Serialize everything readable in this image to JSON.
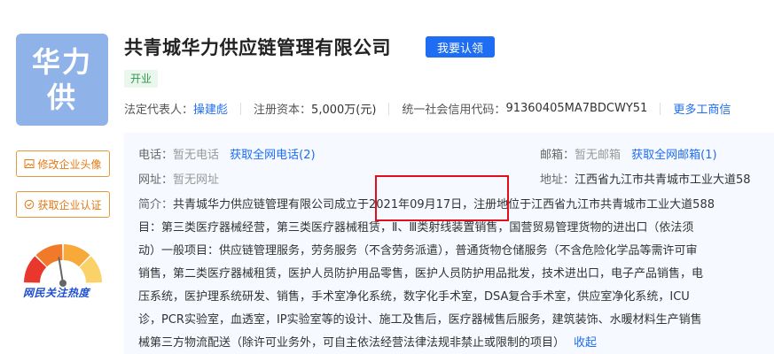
{
  "company": {
    "logo_chars": [
      "华力",
      "供"
    ],
    "name": "共青城华力供应链管理有限公司",
    "claim_label": "我要认领",
    "status": "开业"
  },
  "meta": {
    "legal_rep_label": "法定代表人：",
    "legal_rep": "操建彪",
    "capital_label": "注册资本：",
    "capital": "5,000万(元)",
    "credit_code_label": "统一社会信用代码：",
    "credit_code": "91360405MA7BDCWY51",
    "more_link": "更多工商信"
  },
  "side": {
    "edit_avatar": "修改企业头像",
    "get_cert": "获取企业认证",
    "heat_label": "网民关注热度"
  },
  "contact": {
    "phone_label": "电话：",
    "phone_value": "暂无电话",
    "phone_link": "获取全网电话(2)",
    "email_label": "邮箱：",
    "email_value": "暂无邮箱",
    "email_link": "获取全网邮箱(1)",
    "web_label": "网址：",
    "web_value": "暂无网址",
    "addr_label": "地址：",
    "addr_value": "江西省九江市共青城市工业大道58"
  },
  "intro": {
    "label": "简介：",
    "lines": [
      "共青城华力供应链管理有限公司成立于2021年09月17日，注册地位于江西省九江市共青城市工业大道588",
      "目：第三类医疗器械经营，第三类医疗器械租赁，Ⅱ、Ⅲ类射线装置销售，国营贸易管理货物的进出口（依法须",
      "动）一般项目：供应链管理服务，劳务服务（不含劳务派遣），普通货物仓储服务（不含危险化学品等需许可审",
      "销售，第二类医疗器械租赁，医护人员防护用品零售，医护人员防护用品批发，技术进出口，电子产品销售，电",
      "压系统，医护理系统研发、销售，手术室净化系统，数字化手术室，DSA复合手术室，供应室净化系统，ICU",
      "诊，PCR实验室，血透室，IP实验室等的设计、施工及售后，医疗器械售后服务，建筑装饰、水暖材料生产销售",
      "械第三方物流配送（除许可业务外，可自主依法经营法律法规非禁止或限制的项目）"
    ],
    "collapse": "收起"
  },
  "heat_gauge": {
    "level": 0.45,
    "colors": [
      "#e8372c",
      "#f07a2a",
      "#f7a93a",
      "#fbd26a"
    ]
  }
}
